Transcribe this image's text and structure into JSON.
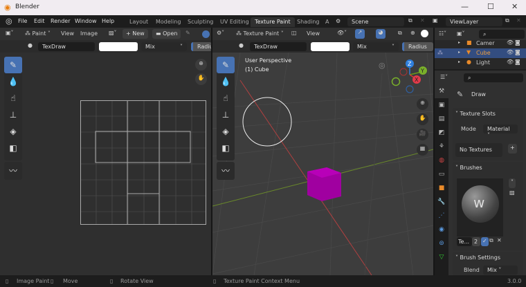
{
  "window": {
    "title": "Blender",
    "minimize": "—",
    "maximize": "☐",
    "close": "✕"
  },
  "menu": [
    "File",
    "Edit",
    "Render",
    "Window",
    "Help"
  ],
  "workspaces": [
    "Layout",
    "Modeling",
    "Sculpting",
    "UV Editing",
    "Texture Paint",
    "Shading",
    "A"
  ],
  "active_workspace": "Texture Paint",
  "scene": "Scene",
  "view_layer": "ViewLayer",
  "image_editor": {
    "mode": "Paint",
    "menus": [
      "View",
      "Image"
    ],
    "new": "+ New",
    "open": "Open",
    "brush": "TexDraw",
    "blend": "Mix",
    "radius": "Radius"
  },
  "viewport": {
    "mode": "Texture Paint",
    "menus": [
      "View"
    ],
    "brush": "TexDraw",
    "blend": "Mix",
    "radius": "Radius",
    "overlay1": "User Perspective",
    "overlay2": "(1) Cube",
    "axes": {
      "x": "X",
      "y": "Y",
      "z": "Z"
    }
  },
  "outliner": {
    "items": [
      {
        "name": "Camer"
      },
      {
        "name": "Cube"
      },
      {
        "name": "Light"
      }
    ]
  },
  "properties": {
    "tool": "Draw",
    "texture_slots": "Texture Slots",
    "mode_label": "Mode",
    "mode": "Material",
    "no_textures": "No Textures",
    "brushes": "Brushes",
    "brush_name": "Te...",
    "brush_users": "2",
    "brush_settings": "Brush Settings",
    "blend_label": "Blend",
    "blend": "Mix"
  },
  "status": {
    "left": "Image Paint",
    "move": "Move",
    "rotate": "Rotate View",
    "context": "Texture Paint Context Menu",
    "version": "3.0.0"
  },
  "colors": {
    "accent": "#4772b3",
    "cube": "#a800a8"
  }
}
